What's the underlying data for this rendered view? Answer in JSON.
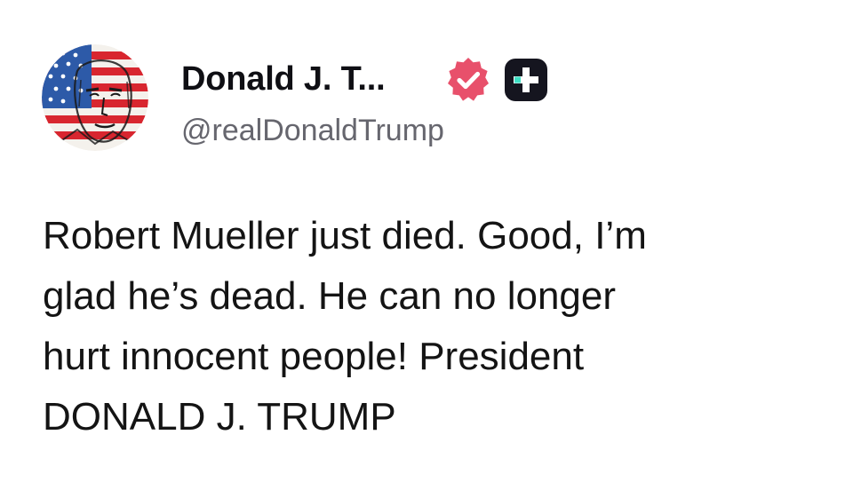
{
  "author": {
    "display_name": "Donald J. T...",
    "handle": "@realDonaldTrump",
    "avatar_icon": "flag-portrait-avatar",
    "verified_icon": "verified-check-badge-icon",
    "verified_color": "#e8506b",
    "plus_icon": "truth-plus-badge-icon"
  },
  "post": {
    "text": "Robert Mueller just died. Good, I’m\nglad he’s dead. He can no longer\nhurt innocent people! President\nDONALD J. TRUMP"
  }
}
